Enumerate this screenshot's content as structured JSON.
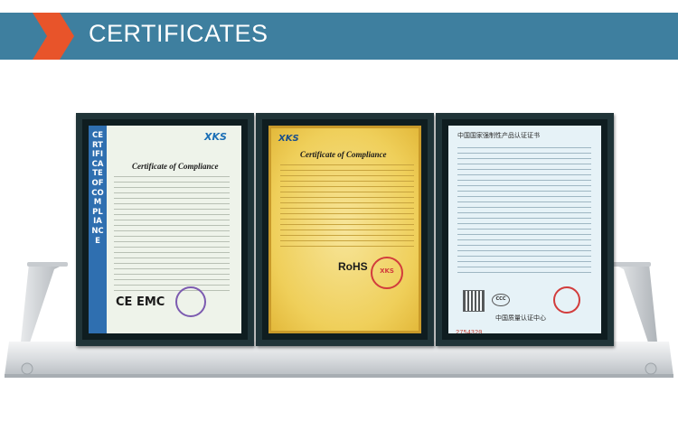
{
  "header": {
    "title": "CERTIFICATES",
    "accent_color": "#e8542a",
    "bar_color": "#3e7f9f"
  },
  "certificates": [
    {
      "side_stripe": "CERTIFICATE OF COMPLIANCE",
      "logo": "XKS",
      "title": "Certificate of Compliance",
      "marks": "CE EMC"
    },
    {
      "logo": "XKS",
      "title": "Certificate of Compliance",
      "standard": "RoHS",
      "seal": "XKS"
    },
    {
      "title": "中国国家强制性产品认证证书",
      "footer": "中国质量认证中心",
      "mark": "CCC",
      "serial": "2754320"
    }
  ]
}
